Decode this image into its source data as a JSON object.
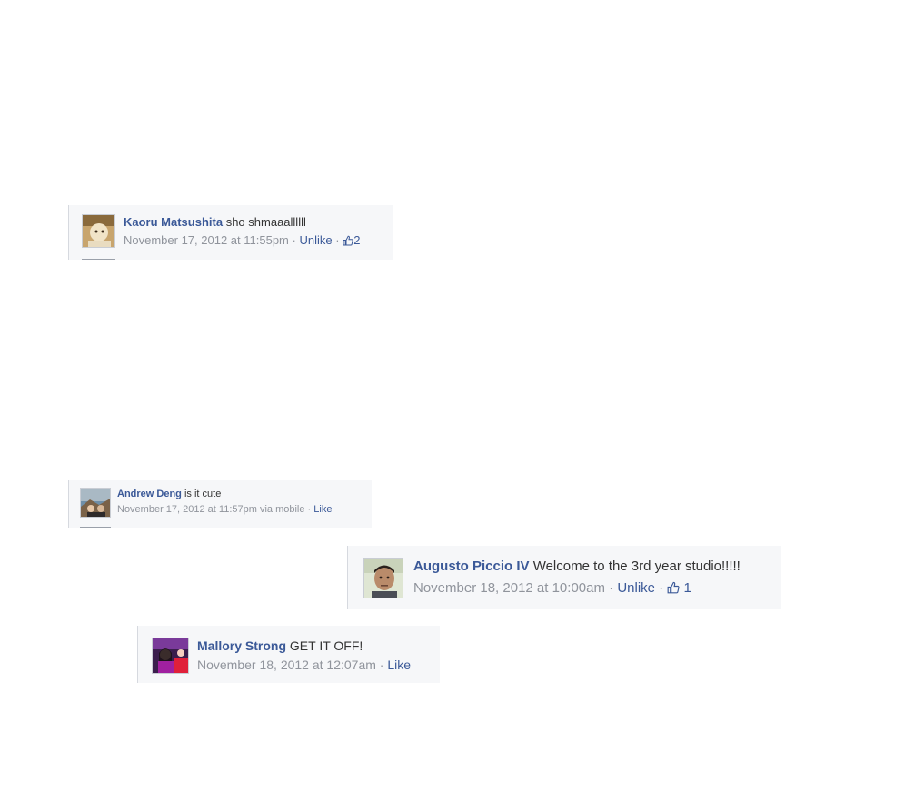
{
  "comments": [
    {
      "author": "Kaoru Matsushita",
      "text": "sho shmaaallllll",
      "timestamp": "November 17, 2012 at 11:55pm",
      "action": "Unlike",
      "likes": "2"
    },
    {
      "author": "Andrew Deng",
      "text": "is it cute",
      "timestamp": "November 17, 2012 at 11:57pm via mobile",
      "action": "Like"
    },
    {
      "author": "Augusto Piccio IV",
      "text": "Welcome to the 3rd year studio!!!!!",
      "timestamp": "November 18, 2012 at 10:00am",
      "action": "Unlike",
      "likes": "1"
    },
    {
      "author": "Mallory Strong",
      "text": "GET IT OFF!",
      "timestamp": "November 18, 2012 at 12:07am",
      "action": "Like"
    }
  ],
  "separator": "·",
  "colors": {
    "link": "#3b5998",
    "meta": "#90949c",
    "background": "#f6f7f9"
  },
  "icons": {
    "like_count": "thumbs-up-icon"
  }
}
